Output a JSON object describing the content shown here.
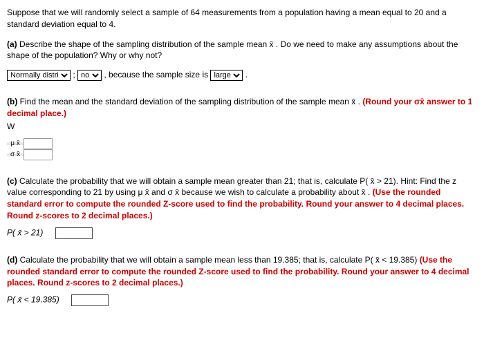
{
  "intro": "Suppose that we will randomly select a sample of 64 measurements from a population having a mean equal to 20 and a standard deviation equal to 4.",
  "partA": {
    "label": "(a)",
    "text": "Describe the shape of the sampling distribution of the sample mean x̄ . Do we need to make any assumptions about the shape of the population? Why or why not?",
    "sel1": "Normally distri",
    "sel2": "no",
    "mid": ", because the sample size is",
    "sel3": "large",
    "end": "."
  },
  "partB": {
    "label": "(b)",
    "text": "Find the mean and the standard deviation of the sampling distribution of the sample mean x̄ .",
    "redText": "(Round your σx̄ answer to 1 decimal place.)",
    "w": "W",
    "row1": "μ x̄",
    "row2": "σ x̄"
  },
  "partC": {
    "label": "(c)",
    "text1": "Calculate the probability that we will obtain a sample mean greater than 21; that is, calculate P( x̄  > 21). Hint: Find the z value corresponding to 21 by using μ x̄ and σ x̄ because we wish to calculate a probability about x̄ .",
    "redText": "(Use the rounded standard error to compute the rounded Z-score used to find the probability. Round your answer to 4 decimal places. Round z-scores to 2 decimal places.)",
    "answerLabel": "P( x̄ > 21)"
  },
  "partD": {
    "label": "(d)",
    "text": "Calculate the probability that we will obtain a sample mean less than 19.385; that is, calculate P( x̄  < 19.385)",
    "redText": "(Use the rounded standard error to compute the rounded Z-score used to find the probability. Round your answer to 4 decimal places. Round z-scores to 2 decimal places.)",
    "answerLabel": "P( x̄ < 19.385)"
  }
}
